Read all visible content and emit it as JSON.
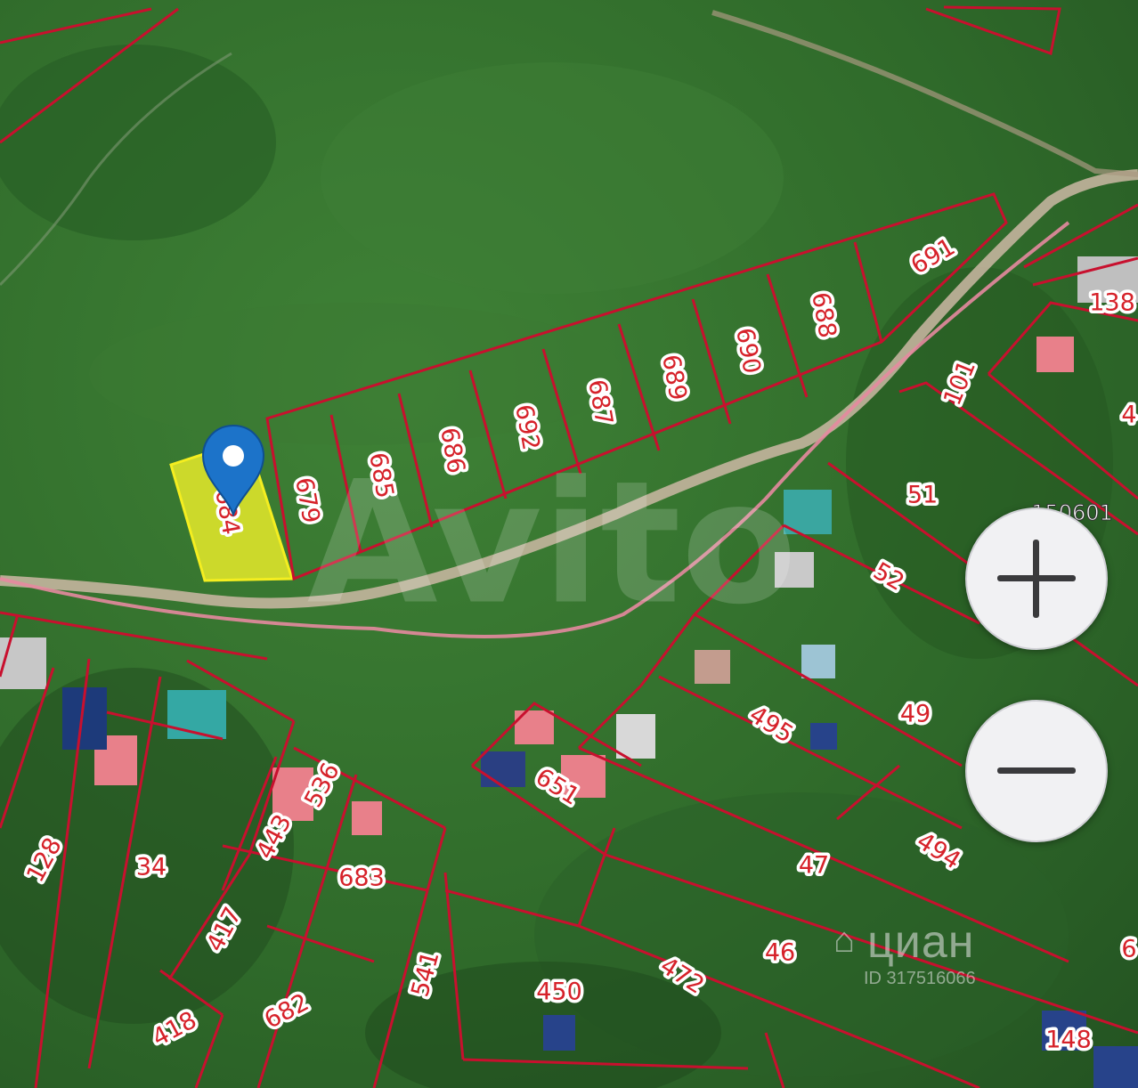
{
  "map": {
    "selected_plot": "684",
    "quarter_number": "150601",
    "plots": [
      "679",
      "685",
      "686",
      "692",
      "687",
      "689",
      "690",
      "688",
      "691",
      "138",
      "101",
      "4",
      "51",
      "52",
      "49",
      "495",
      "651",
      "536",
      "443",
      "683",
      "128",
      "34",
      "417",
      "418",
      "682",
      "541",
      "450",
      "472",
      "47",
      "494",
      "46",
      "148",
      "6"
    ],
    "colors": {
      "boundary": "#c8102e",
      "selected_fill": "#e6ea2a",
      "pin": "#1c73c9",
      "road": "#cdb9a4",
      "path": "#e58aa0"
    }
  },
  "controls": {
    "zoom_in_icon": "plus-icon",
    "zoom_out_icon": "minus-icon"
  },
  "watermarks": {
    "avito": "Avito",
    "cian_word": "циан",
    "cian_id": "ID 317516066"
  }
}
